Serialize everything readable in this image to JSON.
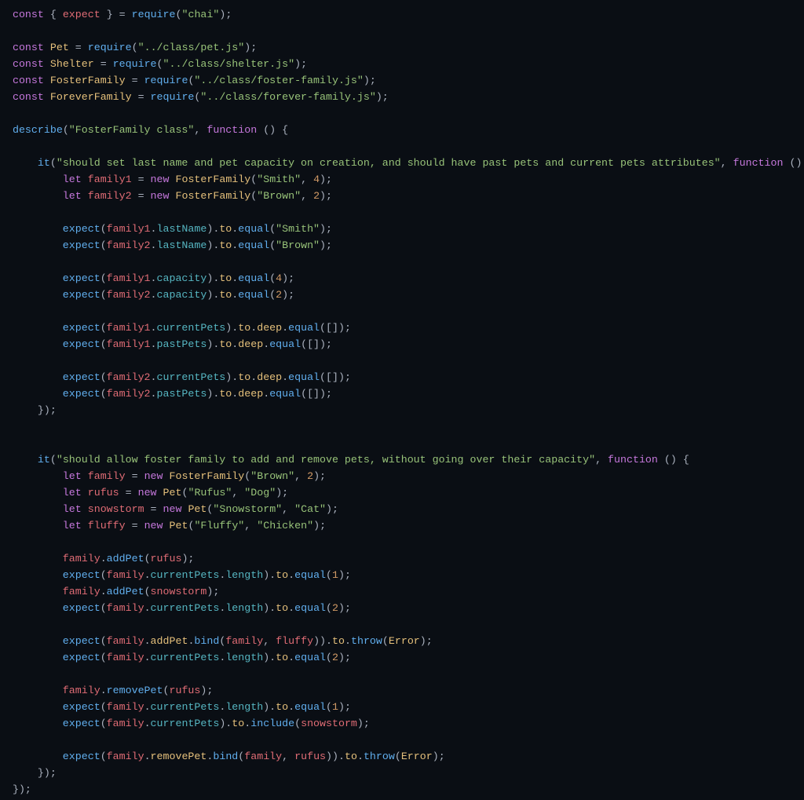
{
  "file": "test/foster-family-spec.js",
  "language": "javascript",
  "imports": {
    "chai_expect": "chai",
    "Pet": "../class/pet.js",
    "Shelter": "../class/shelter.js",
    "FosterFamily": "../class/foster-family.js",
    "ForeverFamily": "../class/forever-family.js"
  },
  "tokens": {
    "kw_const": "const",
    "kw_let": "let",
    "kw_new": "new",
    "kw_function": "function",
    "fn_require": "require",
    "fn_describe": "describe",
    "fn_it": "it",
    "fn_expect": "expect",
    "id_Pet": "Pet",
    "id_Shelter": "Shelter",
    "id_FosterFamily": "FosterFamily",
    "id_ForeverFamily": "ForeverFamily",
    "id_Error": "Error",
    "v_expect": "expect",
    "v_family": "family",
    "v_family1": "family1",
    "v_family2": "family2",
    "v_rufus": "rufus",
    "v_snowstorm": "snowstorm",
    "v_fluffy": "fluffy",
    "chain_to": "to",
    "chain_deep": "deep",
    "m_equal": "equal",
    "m_include": "include",
    "m_throw": "throw",
    "m_addPet": "addPet",
    "m_removePet": "removePet",
    "m_bind": "bind",
    "p_lastName": "lastName",
    "p_capacity": "capacity",
    "p_currentPets": "currentPets",
    "p_pastPets": "pastPets",
    "p_length": "length"
  },
  "strings": {
    "chai": "\"chai\"",
    "pet_path": "\"../class/pet.js\"",
    "shelter_path": "\"../class/shelter.js\"",
    "foster_path": "\"../class/foster-family.js\"",
    "forever_path": "\"../class/forever-family.js\"",
    "describe_title": "\"FosterFamily class\"",
    "it1_title": "\"should set last name and pet capacity on creation, and should have past pets and current pets attributes\"",
    "it2_title": "\"should allow foster family to add and remove pets, without going over their capacity\"",
    "Smith": "\"Smith\"",
    "Brown": "\"Brown\"",
    "Rufus": "\"Rufus\"",
    "Dog": "\"Dog\"",
    "Snowstorm": "\"Snowstorm\"",
    "Cat": "\"Cat\"",
    "Fluffy": "\"Fluffy\"",
    "Chicken": "\"Chicken\""
  },
  "numbers": {
    "n1": "1",
    "n2": "2",
    "n4": "4"
  },
  "test_data": {
    "describe": "FosterFamily class",
    "tests": [
      {
        "title": "should set last name and pet capacity on creation, and should have past pets and current pets attributes",
        "families": [
          {
            "var": "family1",
            "lastName": "Smith",
            "capacity": 4
          },
          {
            "var": "family2",
            "lastName": "Brown",
            "capacity": 2
          }
        ],
        "assertions": [
          "family1.lastName === 'Smith'",
          "family2.lastName === 'Brown'",
          "family1.capacity === 4",
          "family2.capacity === 2",
          "family1.currentPets deep equals []",
          "family1.pastPets deep equals []",
          "family2.currentPets deep equals []",
          "family2.pastPets deep equals []"
        ]
      },
      {
        "title": "should allow foster family to add and remove pets, without going over their capacity",
        "family": {
          "var": "family",
          "lastName": "Brown",
          "capacity": 2
        },
        "pets": [
          {
            "var": "rufus",
            "name": "Rufus",
            "type": "Dog"
          },
          {
            "var": "snowstorm",
            "name": "Snowstorm",
            "type": "Cat"
          },
          {
            "var": "fluffy",
            "name": "Fluffy",
            "type": "Chicken"
          }
        ],
        "steps": [
          "family.addPet(rufus)",
          "expect family.currentPets.length === 1",
          "family.addPet(snowstorm)",
          "expect family.currentPets.length === 2",
          "expect family.addPet.bind(family, fluffy) throws Error",
          "expect family.currentPets.length === 2",
          "family.removePet(rufus)",
          "expect family.currentPets.length === 1",
          "expect family.currentPets includes snowstorm",
          "expect family.removePet.bind(family, rufus) throws Error"
        ]
      }
    ]
  }
}
